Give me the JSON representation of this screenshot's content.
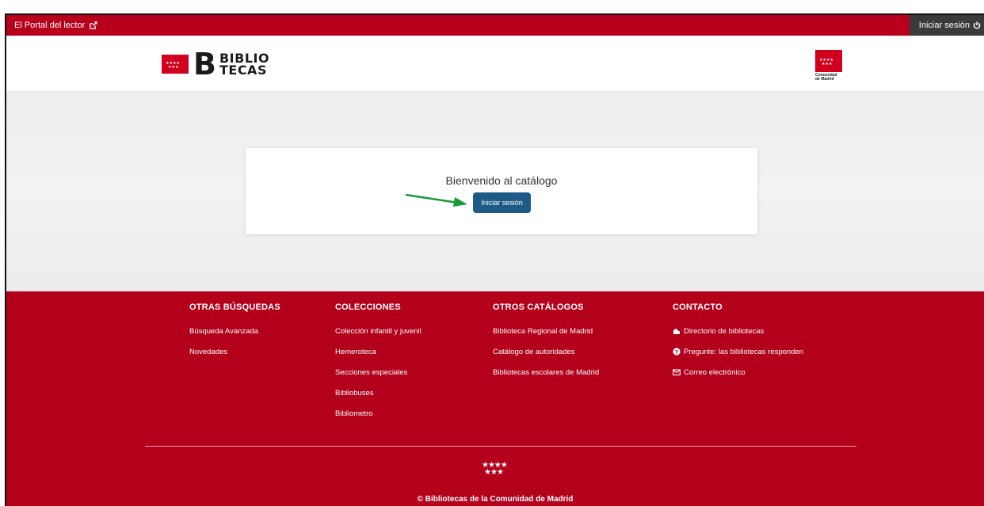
{
  "topbar": {
    "portal_link": "El Portal del lector",
    "login_label": "Iniciar sesión"
  },
  "header": {
    "logo_line1": "BIBLIO",
    "logo_line2": "TECAS",
    "region_logo_line1": "Comunidad",
    "region_logo_line2": "de Madrid"
  },
  "main": {
    "welcome": "Bienvenido al catálogo",
    "login_button": "Iniciar sesión"
  },
  "footer": {
    "columns": [
      {
        "title": "OTRAS BÚSQUEDAS",
        "items": [
          "Búsqueda Avanzada",
          "Novedades"
        ]
      },
      {
        "title": "COLECCIONES",
        "items": [
          "Colección infantil y juvenil",
          "Hemeroteca",
          "Secciones especiales",
          "Bibliobuses",
          "Bibliometro"
        ]
      },
      {
        "title": "OTROS CATÁLOGOS",
        "items": [
          "Biblioteca Regional de Madrid",
          "Catálogo de autoridades",
          "Bibliotecas escolares de Madrid"
        ]
      },
      {
        "title": "CONTACTO",
        "items": [
          "Directorio de bibliotecas",
          "Pregunte: las bibliotecas responden",
          "Correo electrónico"
        ]
      }
    ],
    "stars_row1": "★★★★",
    "stars_row2": "★★★",
    "copyright": "Bibliotecas de la Comunidad de Madrid",
    "copyright_symbol": "©"
  },
  "colors": {
    "brand_red": "#b8001c",
    "button_blue": "#1e5a86",
    "arrow_green": "#1a9a3a"
  }
}
